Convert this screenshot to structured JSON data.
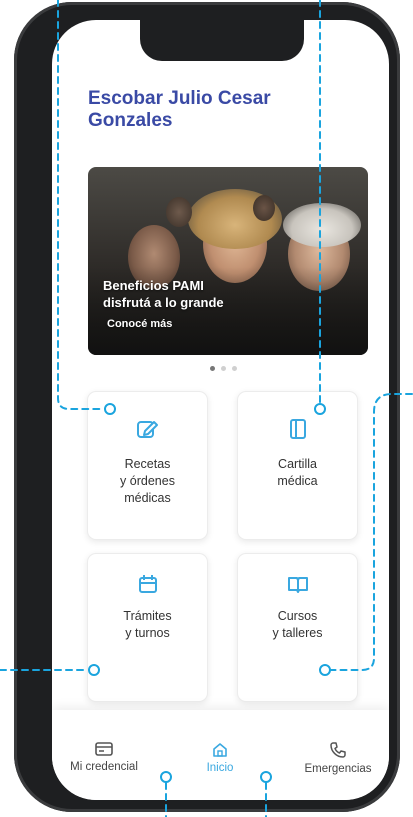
{
  "user": {
    "name": "Escobar Julio Cesar Gonzales"
  },
  "banner": {
    "title_line1": "Beneficios PAMI",
    "title_line2": "disfrutá a lo grande",
    "link_label": "Conocé más"
  },
  "carousel": {
    "active_index": 0,
    "dot_count": 3
  },
  "tiles": [
    {
      "label": "Recetas\ny órdenes\nmédicas",
      "icon": "edit-icon"
    },
    {
      "label": "Cartilla\nmédica",
      "icon": "book-icon"
    },
    {
      "label": "Trámites\ny turnos",
      "icon": "calendar-icon"
    },
    {
      "label": "Cursos\ny talleres",
      "icon": "open-book-icon"
    }
  ],
  "nav": {
    "credential": "Mi credencial",
    "home": "Inicio",
    "emergencies": "Emergencias"
  },
  "colors": {
    "accent": "#3aa8e0",
    "title": "#3a4aa5",
    "annotation": "#1aa4de",
    "phone_frame": "#1e1f21"
  }
}
